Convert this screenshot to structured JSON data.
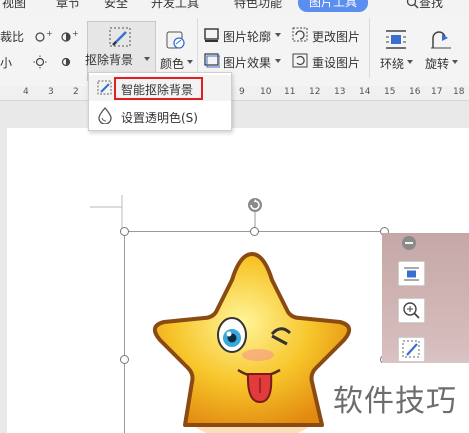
{
  "tabs": [
    "视图",
    "章节",
    "安全",
    "开发工具",
    "特色功能",
    "图片工具",
    "查找"
  ],
  "ribbon": {
    "partial_left": [
      "裁比",
      "小"
    ],
    "remove_bg_label": "抠除背景",
    "color_label": "颜色",
    "outline_label": "图片轮廓",
    "effects_label": "图片效果",
    "change_pic_label": "更改图片",
    "reset_pic_label": "重设图片",
    "wrap_label": "环绕",
    "rotate_label": "旋转"
  },
  "ruler": [
    "4",
    "3",
    "2",
    "9",
    "10",
    "11",
    "12",
    "13",
    "14",
    "15",
    "16",
    "17",
    "18",
    "19"
  ],
  "menu": {
    "item1": "智能抠除背景",
    "item2": "设置透明色(S)"
  },
  "watermark": "软件技巧",
  "colors": {
    "accent": "#5b8ef0",
    "highlight": "#e02020",
    "star": "#f7c52a"
  }
}
